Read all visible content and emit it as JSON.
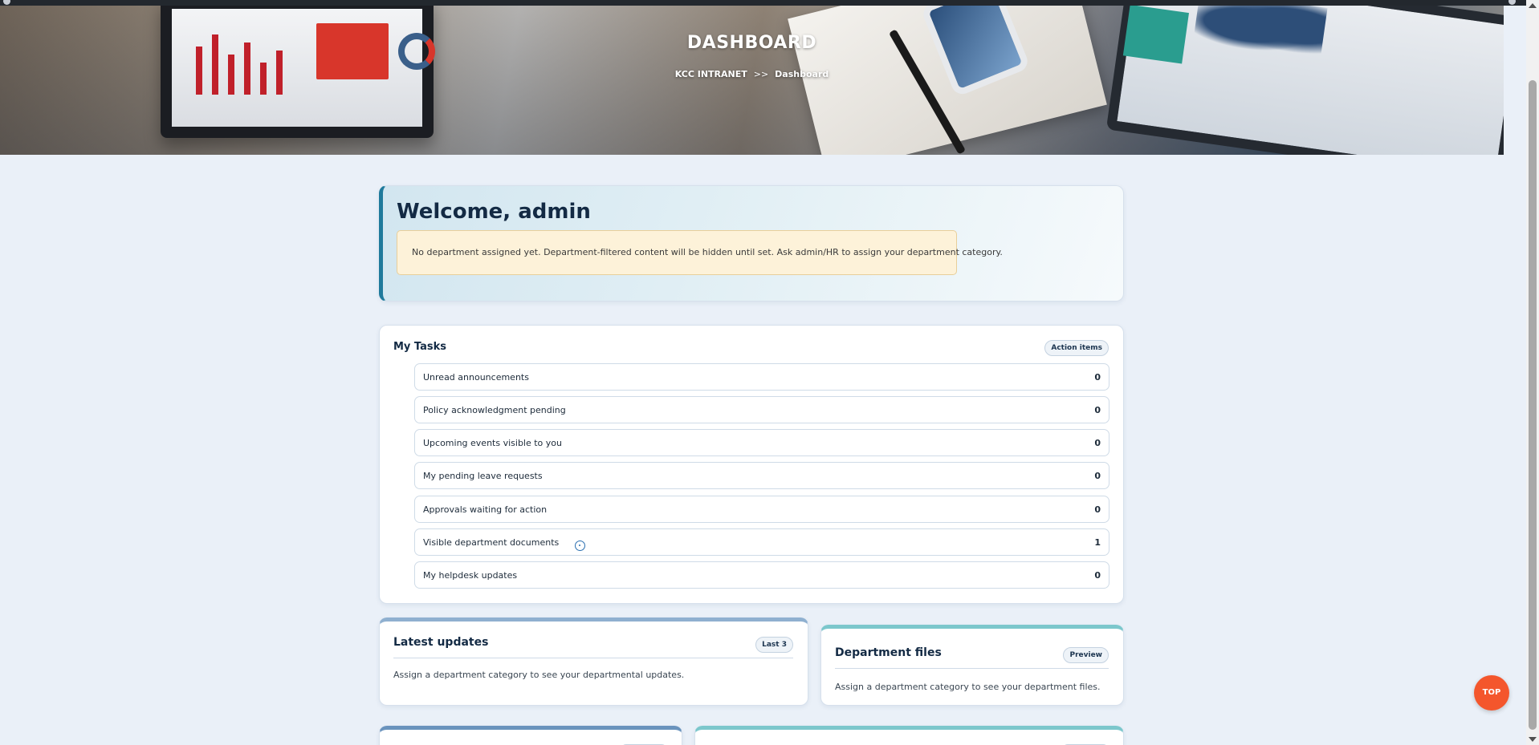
{
  "hero": {
    "title": "DASHBOARD",
    "breadcrumb": {
      "root": "KCC INTRANET",
      "separator": ">>",
      "current": "Dashboard"
    }
  },
  "welcome": {
    "heading": "Welcome, admin",
    "notice": "No department assigned yet. Department-filtered content will be hidden until set. Ask admin/HR to assign your department category."
  },
  "tasks": {
    "title": "My Tasks",
    "badge": "Action items",
    "items": [
      {
        "label": "Unread announcements",
        "count": "0"
      },
      {
        "label": "Policy acknowledgment pending",
        "count": "0"
      },
      {
        "label": "Upcoming events visible to you",
        "count": "0"
      },
      {
        "label": "My pending leave requests",
        "count": "0"
      },
      {
        "label": "Approvals waiting for action",
        "count": "0"
      },
      {
        "label": "Visible department documents",
        "count": "1"
      },
      {
        "label": "My helpdesk updates",
        "count": "0"
      }
    ]
  },
  "latest_updates": {
    "title": "Latest updates",
    "badge": "Last 3",
    "text": "Assign a department category to see your departmental updates."
  },
  "department_files": {
    "title": "Department files",
    "badge": "Preview",
    "text": "Assign a department category to see your department files."
  },
  "top_button": {
    "label": "TOP"
  },
  "colors": {
    "accent": "#1f7a9c",
    "notice_bg": "#fdf2d9",
    "top_button": "#f4562c",
    "page_bg": "#eaf0f8"
  }
}
